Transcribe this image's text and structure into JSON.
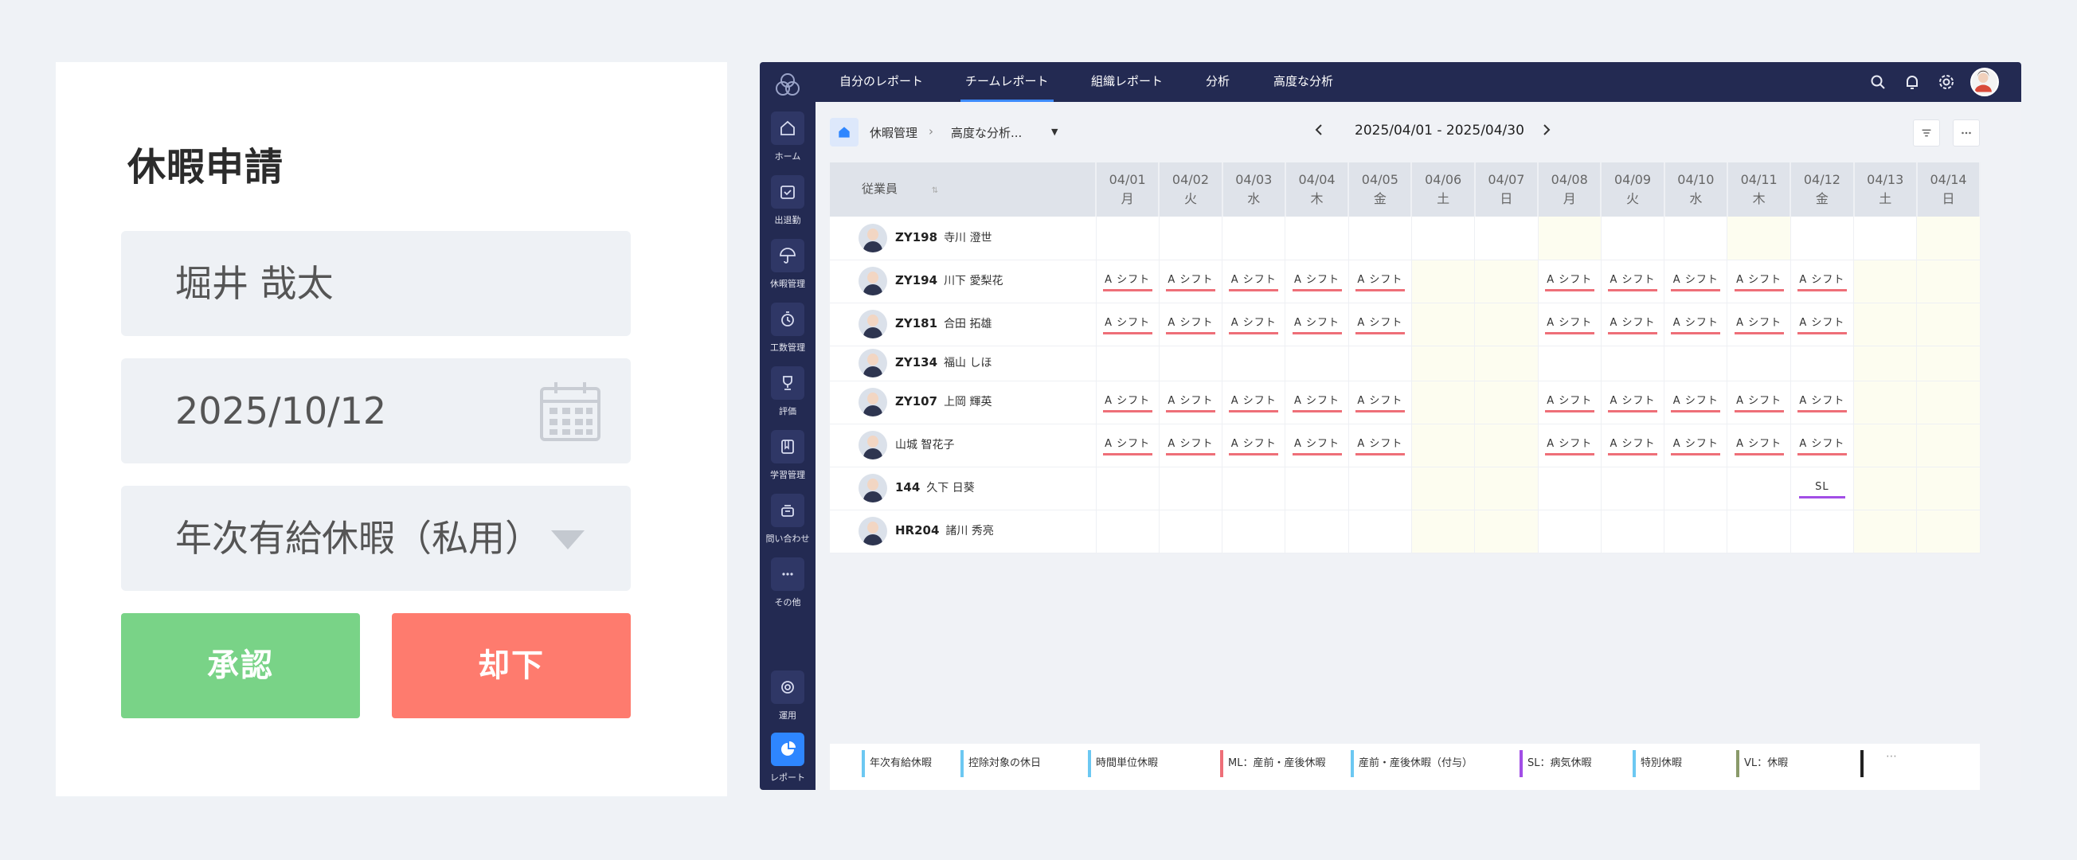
{
  "card": {
    "title": "休暇申請",
    "employee_name": "堀井 哉太",
    "date": "2025/10/12",
    "leave_type": "年次有給休暇（私用）",
    "approve_label": "承認",
    "reject_label": "却下",
    "colors": {
      "approve": "#79d387",
      "reject": "#fe7b6e"
    }
  },
  "app": {
    "tabs": [
      "自分のレポート",
      "チームレポート",
      "組織レポート",
      "分析",
      "高度な分析"
    ],
    "active_tab": "チームレポート",
    "sidebar": [
      {
        "label": "ホーム",
        "icon": "home-icon"
      },
      {
        "label": "出退勤",
        "icon": "clock-in-icon"
      },
      {
        "label": "休暇管理",
        "icon": "umbrella-icon"
      },
      {
        "label": "工数管理",
        "icon": "timer-icon"
      },
      {
        "label": "評価",
        "icon": "trophy-icon"
      },
      {
        "label": "学習管理",
        "icon": "book-icon"
      },
      {
        "label": "問い合わせ",
        "icon": "inbox-icon"
      },
      {
        "label": "その他",
        "icon": "more-icon"
      },
      {
        "label": "運用",
        "icon": "operation-icon"
      },
      {
        "label": "レポート",
        "icon": "pie-chart-icon"
      }
    ],
    "breadcrumb": [
      "休暇管理",
      "高度な分析..."
    ],
    "date_range": "2025/04/01 - 2025/04/30",
    "column_header_employee": "従業員",
    "days": [
      {
        "date": "04/01",
        "dow": "月"
      },
      {
        "date": "04/02",
        "dow": "火"
      },
      {
        "date": "04/03",
        "dow": "水"
      },
      {
        "date": "04/04",
        "dow": "木"
      },
      {
        "date": "04/05",
        "dow": "金"
      },
      {
        "date": "04/06",
        "dow": "土"
      },
      {
        "date": "04/07",
        "dow": "日"
      },
      {
        "date": "04/08",
        "dow": "月"
      },
      {
        "date": "04/09",
        "dow": "火"
      },
      {
        "date": "04/10",
        "dow": "水"
      },
      {
        "date": "04/11",
        "dow": "木"
      },
      {
        "date": "04/12",
        "dow": "金"
      },
      {
        "date": "04/13",
        "dow": "土"
      },
      {
        "date": "04/14",
        "dow": "日"
      }
    ],
    "shift_label": "A シフト",
    "employees": [
      {
        "id": "ZY198",
        "name": "寺川 澄世",
        "cells": [
          "",
          "",
          "",
          "",
          "",
          "",
          "",
          "",
          "",
          "",
          "",
          "",
          "",
          ""
        ]
      },
      {
        "id": "ZY194",
        "name": "川下 愛梨花",
        "cells": [
          "A",
          "A",
          "A",
          "A",
          "A",
          "",
          "",
          "A",
          "A",
          "A",
          "A",
          "A",
          "",
          ""
        ]
      },
      {
        "id": "ZY181",
        "name": "合田 拓雄",
        "cells": [
          "A",
          "A",
          "A",
          "A",
          "A",
          "",
          "",
          "A",
          "A",
          "A",
          "A",
          "A",
          "",
          ""
        ]
      },
      {
        "id": "ZY134",
        "name": "福山 しほ",
        "cells": [
          "",
          "",
          "",
          "",
          "",
          "",
          "",
          "",
          "",
          "",
          "",
          "",
          "",
          ""
        ]
      },
      {
        "id": "ZY107",
        "name": "上岡 輝英",
        "cells": [
          "A",
          "A",
          "A",
          "A",
          "A",
          "",
          "",
          "A",
          "A",
          "A",
          "A",
          "A",
          "",
          ""
        ]
      },
      {
        "id": "",
        "name": "山城 智花子",
        "cells": [
          "A",
          "A",
          "A",
          "A",
          "A",
          "",
          "",
          "A",
          "A",
          "A",
          "A",
          "A",
          "",
          ""
        ]
      },
      {
        "id": "144",
        "name": "久下 日葵",
        "cells": [
          "",
          "",
          "",
          "",
          "",
          "",
          "",
          "",
          "",
          "",
          "",
          "SL",
          "",
          ""
        ]
      },
      {
        "id": "HR204",
        "name": "諸川 秀亮",
        "cells": [
          "",
          "",
          "",
          "",
          "",
          "",
          "",
          "",
          "",
          "",
          "",
          "",
          "",
          ""
        ]
      }
    ],
    "legend": [
      {
        "label": "年次有給休暇",
        "color": "#6cc8f2"
      },
      {
        "label": "控除対象の休日",
        "color": "#6cc8f2"
      },
      {
        "label": "時間単位休暇",
        "color": "#6cc8f2"
      },
      {
        "label": "ML：産前・産後休暇",
        "color": "#ee6f78"
      },
      {
        "label": "産前・産後休暇（付与）",
        "color": "#6cc8f2"
      },
      {
        "label": "SL：病気休暇",
        "color": "#a24ee6"
      },
      {
        "label": "特別休暇",
        "color": "#6cc8f2"
      },
      {
        "label": "VL：休暇",
        "color": "#8a9a6a"
      },
      {
        "label": "",
        "color": "#222222"
      }
    ],
    "legend_more": "⋯"
  }
}
